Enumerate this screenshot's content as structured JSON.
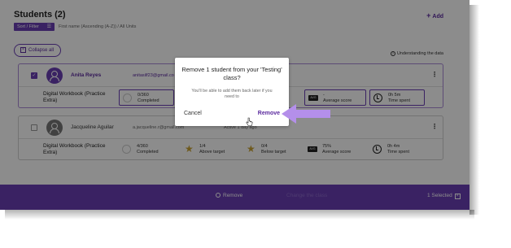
{
  "page": {
    "title": "Students (2)",
    "add_label": "Add",
    "sort_label": "Sort / Filter",
    "sort_description": "First name (Ascending (A-Z)) / All Units",
    "collapse_label": "Collapse all",
    "understanding_label": "Understanding the data"
  },
  "students": [
    {
      "name": "Anita Reyes",
      "email": "anitasilf23@gmail.co",
      "activity": "",
      "selected": true,
      "product": "Digital Workbook (Practice Extra)",
      "completed": {
        "value": "0/360",
        "label": "Completed"
      },
      "above": {
        "value": "",
        "label": ""
      },
      "below": {
        "value": "",
        "label": ""
      },
      "average": {
        "badge": "AVG",
        "value": "-",
        "label": "Average score"
      },
      "time": {
        "value": "0h 5m",
        "label": "Time spent"
      }
    },
    {
      "name": "Jacqueline Aguilar",
      "email": "a.jacqueline.r@gmail.com",
      "activity": "Active 1 day ago",
      "selected": false,
      "product": "Digital Workbook (Practice Extra)",
      "completed": {
        "value": "4/360",
        "label": "Completed"
      },
      "above": {
        "value": "1/4",
        "label": "Above target"
      },
      "below": {
        "value": "0/4",
        "label": "Below target"
      },
      "average": {
        "badge": "AVG",
        "value": "75%",
        "label": "Average score"
      },
      "time": {
        "value": "0h 4m",
        "label": "Time spent"
      }
    }
  ],
  "bottom_bar": {
    "remove_label": "Remove",
    "faded_label": "Change the class",
    "selected_label": "1 Selected"
  },
  "modal": {
    "title": "Remove 1 student from your 'Testing' class?",
    "body": "You'll be able to add them back later if you need to",
    "cancel_label": "Cancel",
    "remove_label": "Remove"
  },
  "colors": {
    "accent": "#6a3fb5",
    "arrow": "#b48fea"
  }
}
